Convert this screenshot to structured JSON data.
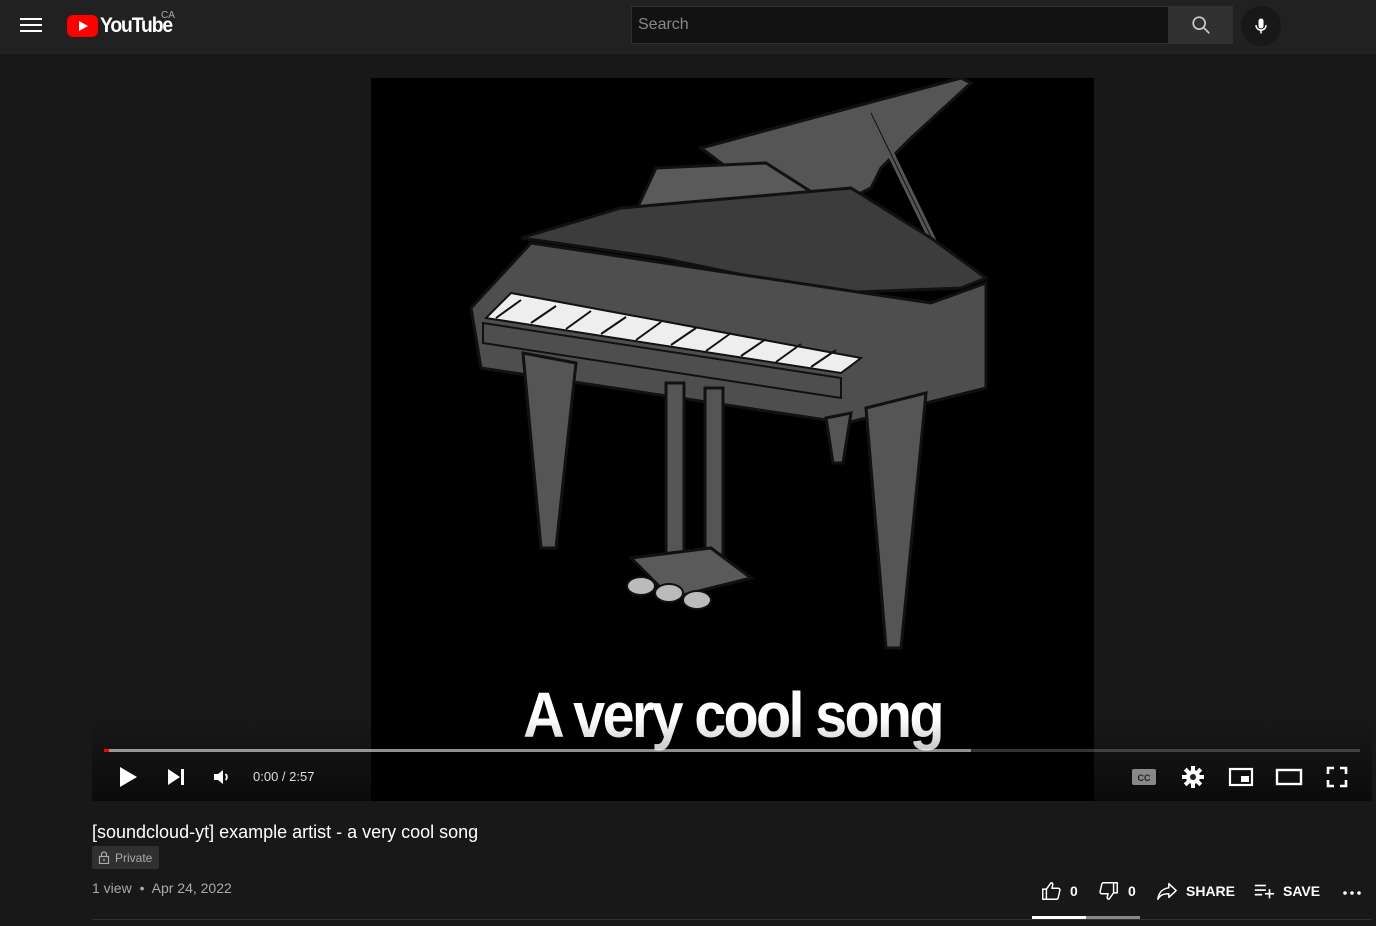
{
  "masthead": {
    "logo_text": "YouTube",
    "country_code": "CA",
    "search_placeholder": "Search",
    "icons": [
      "menu-icon",
      "search-icon",
      "microphone-icon"
    ]
  },
  "player": {
    "video_caption": "A very cool song",
    "time": "0:00 / 2:57",
    "played_fraction": 0.0,
    "loaded_fraction": 0.69,
    "icons": [
      "play-icon",
      "next-icon",
      "volume-icon",
      "captions-icon",
      "settings-icon",
      "miniplayer-icon",
      "theater-icon",
      "fullscreen-icon"
    ]
  },
  "video": {
    "title": "[soundcloud-yt] example artist - a very cool song",
    "privacy": "Private",
    "views": "1 view",
    "date": "Apr 24, 2022",
    "separator": "•"
  },
  "actions": {
    "like_count": "0",
    "dislike_count": "0",
    "share_label": "SHARE",
    "save_label": "SAVE",
    "more_icon": "more-icon"
  },
  "colors": {
    "brand_red": "#ff0000",
    "background": "#181818",
    "masthead": "#212121"
  }
}
